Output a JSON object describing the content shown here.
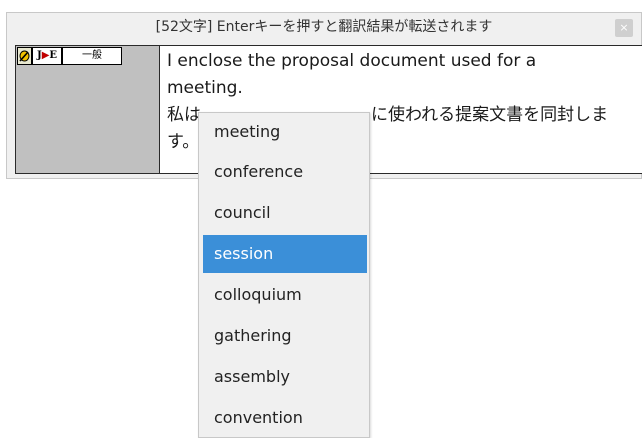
{
  "window": {
    "title": "[52文字] Enterキーを押すと翻訳結果が転送されます",
    "close_label": "×"
  },
  "toolbar": {
    "mode_icon": "pencil-icon",
    "direction_from": "J",
    "direction_arrow": "▶",
    "direction_to": "E",
    "category": "一般"
  },
  "content": {
    "english_line1": "I enclose the proposal document used for a",
    "english_line2": "meeting.",
    "japanese_line1_prefix": "私は",
    "japanese_line1_suffix": "に使われる提案文書を同封しま",
    "japanese_line2": "す。"
  },
  "dropdown": {
    "items": [
      {
        "label": "meeting"
      },
      {
        "label": "conference"
      },
      {
        "label": "council"
      },
      {
        "label": "session"
      },
      {
        "label": "colloquium"
      },
      {
        "label": "gathering"
      },
      {
        "label": "assembly"
      },
      {
        "label": "convention"
      }
    ],
    "selected_label": "session",
    "colors": {
      "selected_bg": "#3b8fd8",
      "selected_text": "#ffffff"
    }
  }
}
